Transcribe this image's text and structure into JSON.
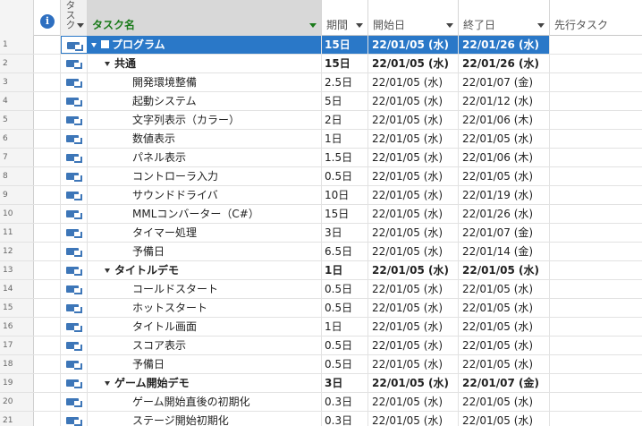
{
  "columns": {
    "mode": "タスク",
    "name": "タスク名",
    "duration": "期間",
    "start": "開始日",
    "end": "終了日",
    "predecessors": "先行タスク"
  },
  "rows": [
    {
      "id": "1",
      "name": "プログラム",
      "duration": "15日",
      "start": "22/01/05 (水)",
      "end": "22/01/26 (水)",
      "level": 0,
      "summary": true,
      "selected": true
    },
    {
      "id": "2",
      "name": "共通",
      "duration": "15日",
      "start": "22/01/05 (水)",
      "end": "22/01/26 (水)",
      "level": 1,
      "summary": true
    },
    {
      "id": "3",
      "name": "開発環境整備",
      "duration": "2.5日",
      "start": "22/01/05 (水)",
      "end": "22/01/07 (金)",
      "level": 2
    },
    {
      "id": "4",
      "name": "起動システム",
      "duration": "5日",
      "start": "22/01/05 (水)",
      "end": "22/01/12 (水)",
      "level": 2
    },
    {
      "id": "5",
      "name": "文字列表示（カラー）",
      "duration": "2日",
      "start": "22/01/05 (水)",
      "end": "22/01/06 (木)",
      "level": 2
    },
    {
      "id": "6",
      "name": "数値表示",
      "duration": "1日",
      "start": "22/01/05 (水)",
      "end": "22/01/05 (水)",
      "level": 2
    },
    {
      "id": "7",
      "name": "パネル表示",
      "duration": "1.5日",
      "start": "22/01/05 (水)",
      "end": "22/01/06 (木)",
      "level": 2
    },
    {
      "id": "8",
      "name": "コントローラ入力",
      "duration": "0.5日",
      "start": "22/01/05 (水)",
      "end": "22/01/05 (水)",
      "level": 2
    },
    {
      "id": "9",
      "name": "サウンドドライバ",
      "duration": "10日",
      "start": "22/01/05 (水)",
      "end": "22/01/19 (水)",
      "level": 2
    },
    {
      "id": "10",
      "name": "MMLコンバーター（C#）",
      "duration": "15日",
      "start": "22/01/05 (水)",
      "end": "22/01/26 (水)",
      "level": 2
    },
    {
      "id": "11",
      "name": "タイマー処理",
      "duration": "3日",
      "start": "22/01/05 (水)",
      "end": "22/01/07 (金)",
      "level": 2
    },
    {
      "id": "12",
      "name": "予備日",
      "duration": "6.5日",
      "start": "22/01/05 (水)",
      "end": "22/01/14 (金)",
      "level": 2
    },
    {
      "id": "13",
      "name": "タイトルデモ",
      "duration": "1日",
      "start": "22/01/05 (水)",
      "end": "22/01/05 (水)",
      "level": 1,
      "summary": true
    },
    {
      "id": "14",
      "name": "コールドスタート",
      "duration": "0.5日",
      "start": "22/01/05 (水)",
      "end": "22/01/05 (水)",
      "level": 2
    },
    {
      "id": "15",
      "name": "ホットスタート",
      "duration": "0.5日",
      "start": "22/01/05 (水)",
      "end": "22/01/05 (水)",
      "level": 2
    },
    {
      "id": "16",
      "name": "タイトル画面",
      "duration": "1日",
      "start": "22/01/05 (水)",
      "end": "22/01/05 (水)",
      "level": 2
    },
    {
      "id": "17",
      "name": "スコア表示",
      "duration": "0.5日",
      "start": "22/01/05 (水)",
      "end": "22/01/05 (水)",
      "level": 2
    },
    {
      "id": "18",
      "name": "予備日",
      "duration": "0.5日",
      "start": "22/01/05 (水)",
      "end": "22/01/05 (水)",
      "level": 2
    },
    {
      "id": "19",
      "name": "ゲーム開始デモ",
      "duration": "3日",
      "start": "22/01/05 (水)",
      "end": "22/01/07 (金)",
      "level": 1,
      "summary": true
    },
    {
      "id": "20",
      "name": "ゲーム開始直後の初期化",
      "duration": "0.3日",
      "start": "22/01/05 (水)",
      "end": "22/01/05 (水)",
      "level": 2
    },
    {
      "id": "21",
      "name": "ステージ開始初期化",
      "duration": "0.3日",
      "start": "22/01/05 (水)",
      "end": "22/01/05 (水)",
      "level": 2
    }
  ]
}
